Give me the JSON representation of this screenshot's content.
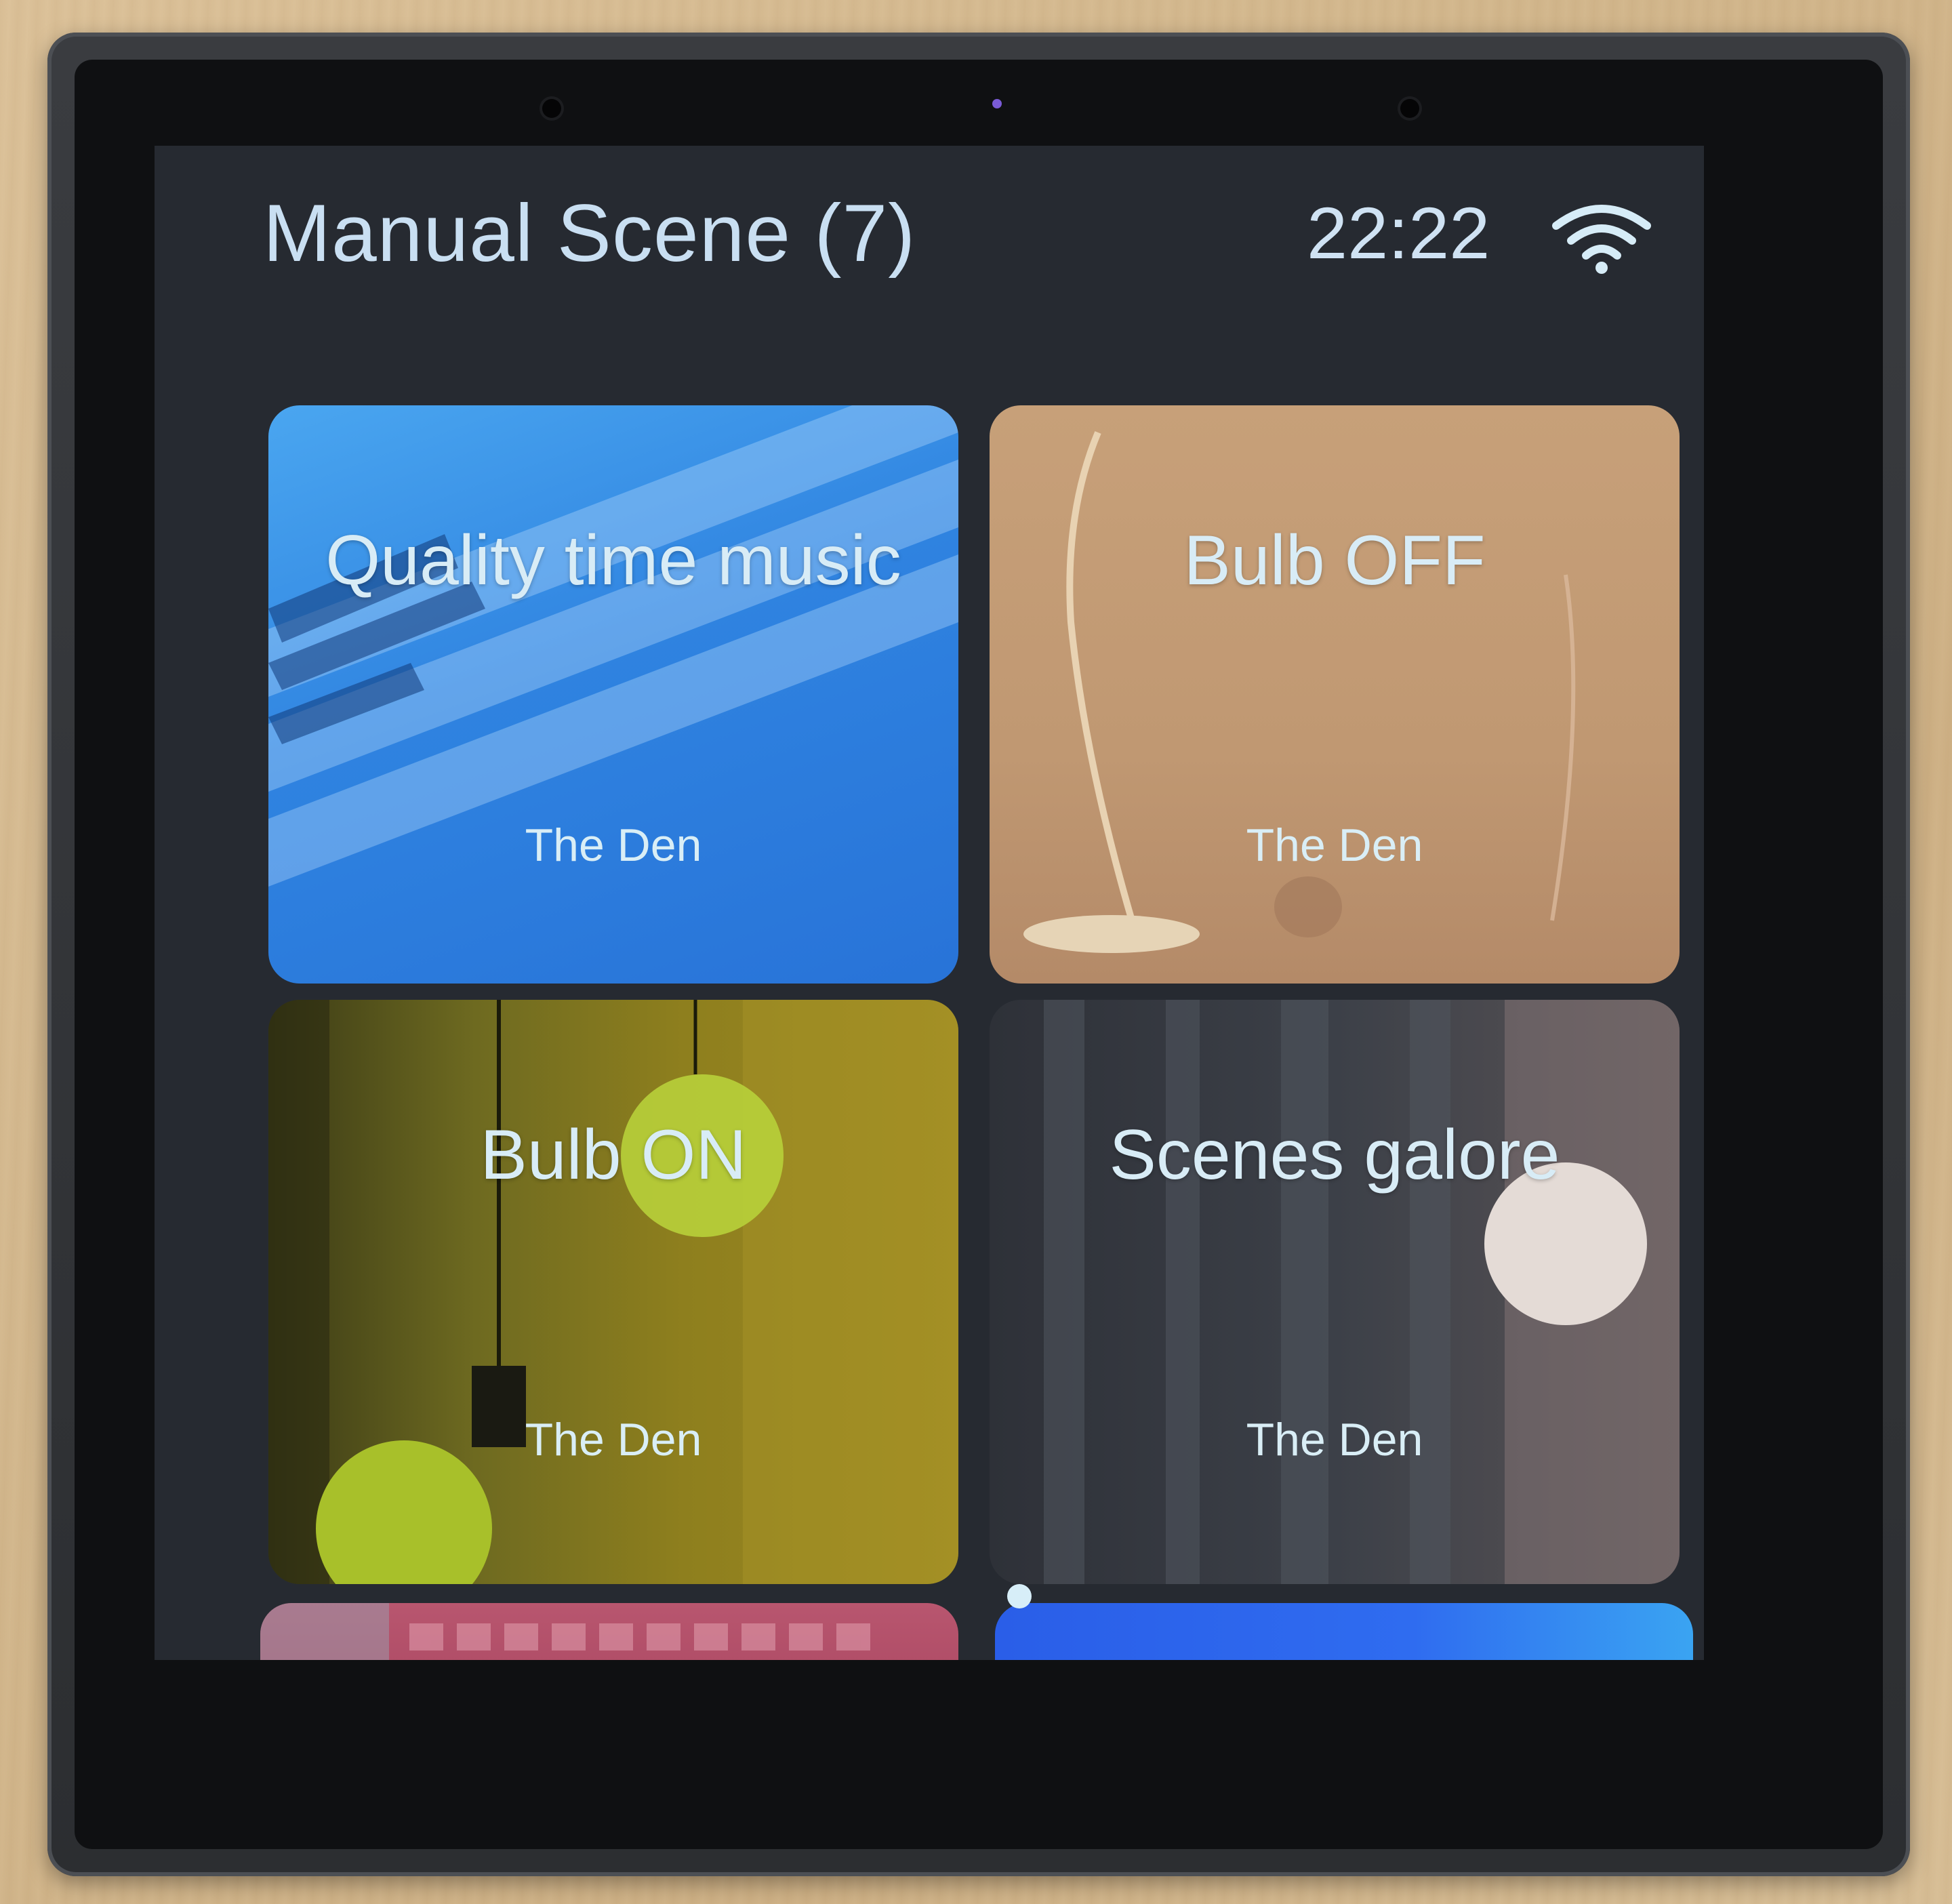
{
  "header": {
    "title": "Manual Scene (7)",
    "time": "22:22",
    "wifi_icon": "wifi-icon"
  },
  "scenes": [
    {
      "name": "Quality time music",
      "room": "The Den",
      "theme": "piano-blue"
    },
    {
      "name": "Bulb OFF",
      "room": "The Den",
      "theme": "lamp-beige"
    },
    {
      "name": "Bulb ON",
      "room": "The Den",
      "theme": "bulb-green"
    },
    {
      "name": "Scenes galore",
      "room": "The Den",
      "theme": "curtain-grey"
    }
  ],
  "colors": {
    "screen_bg": "#262a31",
    "text": "#c9dff2",
    "accent_blue": "#2f83e0"
  }
}
